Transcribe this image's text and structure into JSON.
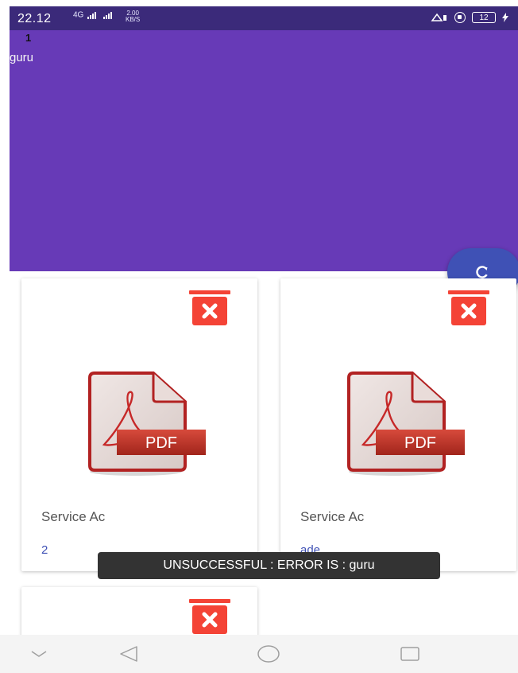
{
  "status_bar": {
    "time": "22.12",
    "network": "4G",
    "speed_value": "2.00",
    "speed_unit": "KB/S",
    "battery": "12"
  },
  "header": {
    "number": "1",
    "name": "guru",
    "background": "#673ab7"
  },
  "fab": {
    "icon": "refresh-icon",
    "color": "#3f51b5"
  },
  "cards": [
    {
      "title": "Service Ac",
      "value": "2",
      "icon": "pdf-file-icon"
    },
    {
      "title": "Service Ac",
      "value": "ade",
      "icon": "pdf-file-icon"
    },
    {
      "title": "",
      "value": "",
      "icon": "pdf-file-icon"
    }
  ],
  "pdf_label": "PDF",
  "toast": {
    "message": "UNSUCCESSFUL :  ERROR IS : guru"
  },
  "nav": {
    "items": [
      "chevron-down-icon",
      "back-icon",
      "home-icon",
      "recents-icon"
    ]
  },
  "colors": {
    "delete": "#f44336",
    "accent": "#3f51b5"
  }
}
